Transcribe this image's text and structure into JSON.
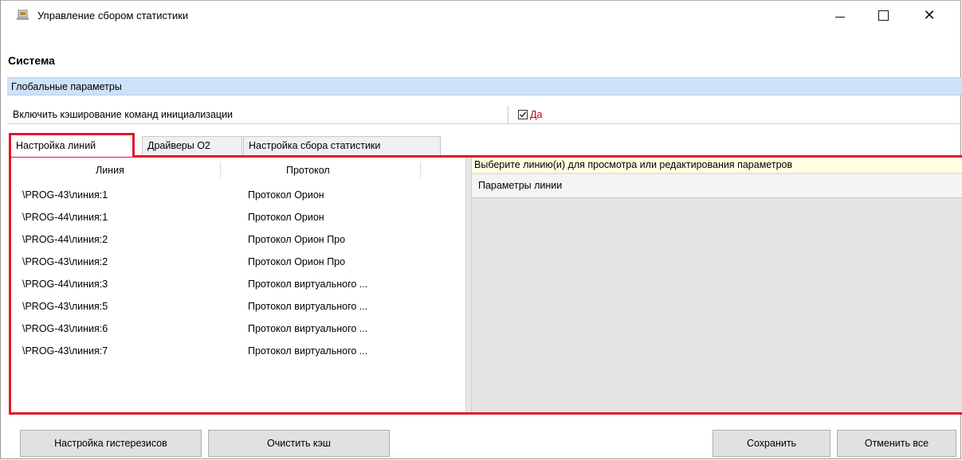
{
  "window": {
    "title": "Управление сбором статистики",
    "controls": {
      "minimize": "—",
      "maximize": "",
      "close": "✕"
    }
  },
  "section": {
    "title": "Система"
  },
  "global_params": {
    "header": "Глобальные параметры",
    "property_label": "Включить кэширование команд инициализации",
    "property_value": "Да",
    "checked": true
  },
  "tabs": [
    {
      "label": "Настройка линий",
      "active": true
    },
    {
      "label": "Драйверы О2",
      "active": false
    },
    {
      "label": "Настройка сбора статистики",
      "active": false
    }
  ],
  "lines_table": {
    "columns": [
      "Линия",
      "Протокол"
    ],
    "rows": [
      [
        "\\PROG-43\\линия:1",
        "Протокол Орион"
      ],
      [
        "\\PROG-44\\линия:1",
        "Протокол Орион"
      ],
      [
        "\\PROG-44\\линия:2",
        "Протокол Орион Про"
      ],
      [
        "\\PROG-43\\линия:2",
        "Протокол Орион Про"
      ],
      [
        "\\PROG-44\\линия:3",
        "Протокол виртуального ..."
      ],
      [
        "\\PROG-43\\линия:5",
        "Протокол виртуального ..."
      ],
      [
        "\\PROG-43\\линия:6",
        "Протокол виртуального ..."
      ],
      [
        "\\PROG-43\\линия:7",
        "Протокол виртуального ..."
      ]
    ]
  },
  "right_panel": {
    "hint": "Выберите линию(и) для просмотра или редактирования параметров",
    "header": "Параметры линии"
  },
  "buttons": {
    "hysteresis": "Настройка гистерезисов",
    "clear_cache": "Очистить кэш",
    "save": "Сохранить",
    "cancel_all": "Отменить все"
  },
  "colors": {
    "highlight_border": "#e0182a",
    "global_band": "#cde2f8",
    "hint_bg": "#ffffe1",
    "value_text": "#c00000"
  }
}
